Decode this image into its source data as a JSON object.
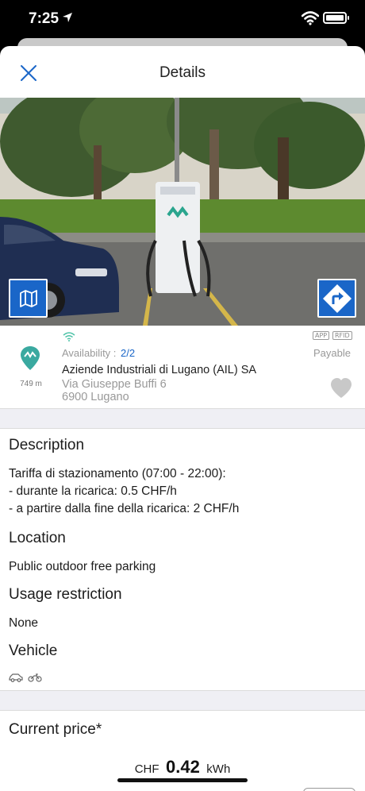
{
  "status": {
    "time": "7:25"
  },
  "nav": {
    "title": "Details"
  },
  "station": {
    "distance": "749 m",
    "availability_label": "Availability :",
    "availability_value": "2/2",
    "tags": [
      "APP",
      "RFID"
    ],
    "payment": "Payable",
    "name": "Aziende Industriali di Lugano (AIL) SA",
    "street": "Via Giuseppe Buffi 6",
    "city": "6900 Lugano"
  },
  "description": {
    "title": "Description",
    "lines": [
      "Tariffa di stazionamento (07:00 - 22:00):",
      "- durante la ricarica: 0.5 CHF/h",
      "- a partire dalla fine della ricarica: 2 CHF/h"
    ]
  },
  "location": {
    "title": "Location",
    "text": "Public outdoor free parking"
  },
  "usage_restriction": {
    "title": "Usage restriction",
    "text": "None"
  },
  "vehicle": {
    "title": "Vehicle",
    "icons": [
      "car-icon",
      "motorbike-icon"
    ]
  },
  "price": {
    "title": "Current price*",
    "currency": "CHF",
    "value": "0.42",
    "unit": "kWh"
  },
  "colors": {
    "accent": "#1a66c8",
    "pin": "#3aa9a0",
    "signal": "#4fc3a8"
  }
}
